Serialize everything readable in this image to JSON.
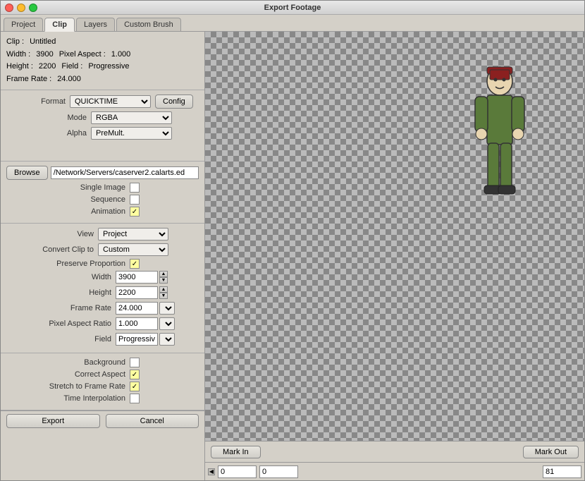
{
  "window": {
    "title": "Export Footage"
  },
  "tabs": [
    {
      "id": "project",
      "label": "Project",
      "active": false
    },
    {
      "id": "clip",
      "label": "Clip",
      "active": true
    },
    {
      "id": "layers",
      "label": "Layers",
      "active": false
    },
    {
      "id": "custom-brush",
      "label": "Custom Brush",
      "active": false
    }
  ],
  "clip_info": {
    "clip_label": "Clip :",
    "clip_value": "Untitled",
    "width_label": "Width :",
    "width_value": "3900",
    "pixel_aspect_label": "Pixel Aspect :",
    "pixel_aspect_value": "1.000",
    "height_label": "Height :",
    "height_value": "2200",
    "field_label": "Field :",
    "field_value": "Progressive",
    "frame_rate_label": "Frame Rate :",
    "frame_rate_value": "24.000"
  },
  "format": {
    "label": "Format",
    "format_value": "QUICKTIME",
    "config_label": "Config",
    "mode_label": "Mode",
    "mode_value": "RGBA",
    "alpha_label": "Alpha",
    "alpha_value": "PreMult."
  },
  "file": {
    "browse_label": "Browse",
    "path_value": "/Network/Servers/caserver2.calarts.ed",
    "single_image_label": "Single Image",
    "single_image_checked": false,
    "sequence_label": "Sequence",
    "sequence_checked": false,
    "animation_label": "Animation",
    "animation_checked": true
  },
  "settings": {
    "view_label": "View",
    "view_value": "Project",
    "convert_clip_label": "Convert Clip to",
    "convert_clip_value": "Custom",
    "preserve_proportion_label": "Preserve Proportion",
    "preserve_proportion_checked": true,
    "width_label": "Width",
    "width_value": "3900",
    "height_label": "Height",
    "height_value": "2200",
    "frame_rate_label": "Frame Rate",
    "frame_rate_value": "24.000",
    "pixel_aspect_label": "Pixel Aspect Ratio",
    "pixel_aspect_value": "1.000",
    "field_label": "Field",
    "field_value": "Progressive"
  },
  "output": {
    "background_label": "Background",
    "background_checked": false,
    "correct_aspect_label": "Correct Aspect",
    "correct_aspect_checked": true,
    "stretch_label": "Stretch to Frame Rate",
    "stretch_checked": true,
    "time_interpolation_label": "Time Interpolation",
    "time_interpolation_checked": false
  },
  "marks": {
    "mark_in_label": "Mark In",
    "mark_out_label": "Mark Out",
    "frame_in_value": "0",
    "frame_mid_value": "0",
    "frame_out_value": "81"
  },
  "buttons": {
    "export_label": "Export",
    "cancel_label": "Cancel"
  }
}
